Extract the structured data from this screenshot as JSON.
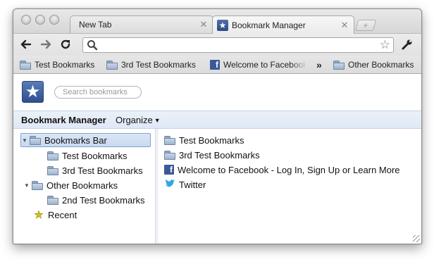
{
  "tabs": [
    {
      "title": "New Tab"
    },
    {
      "title": "Bookmark Manager",
      "icon": "bookmark-star-icon"
    }
  ],
  "omnibox": {
    "value": "",
    "placeholder": ""
  },
  "bookmarks_bar": {
    "items": [
      {
        "label": "Test Bookmarks",
        "icon": "folder-icon"
      },
      {
        "label": "3rd Test Bookmarks",
        "icon": "folder-icon"
      },
      {
        "label": "Welcome to Facebook",
        "icon": "facebook-icon"
      },
      {
        "label": "Other Bookmarks",
        "icon": "folder-icon"
      }
    ],
    "overflow_label": "»"
  },
  "manager": {
    "search_placeholder": "Search bookmarks",
    "title": "Bookmark Manager",
    "organize_label": "Organize"
  },
  "tree": [
    {
      "label": "Bookmarks Bar",
      "expanded": true,
      "selected": true
    },
    {
      "label": "Test Bookmarks"
    },
    {
      "label": "3rd Test Bookmarks"
    },
    {
      "label": "Other Bookmarks",
      "expanded": true
    },
    {
      "label": "2nd Test Bookmarks"
    },
    {
      "label": "Recent",
      "icon": "star-icon"
    }
  ],
  "list": [
    {
      "label": "Test Bookmarks",
      "icon": "folder-icon"
    },
    {
      "label": "3rd Test Bookmarks",
      "icon": "folder-icon"
    },
    {
      "label": "Welcome to Facebook - Log In, Sign Up or Learn More",
      "icon": "facebook-icon"
    },
    {
      "label": "Twitter",
      "icon": "twitter-icon"
    }
  ],
  "colors": {
    "selection_bg": "#c8d9f1",
    "header_bg": "#dfe8f5",
    "facebook": "#3b5998",
    "twitter": "#2fa7e0"
  }
}
